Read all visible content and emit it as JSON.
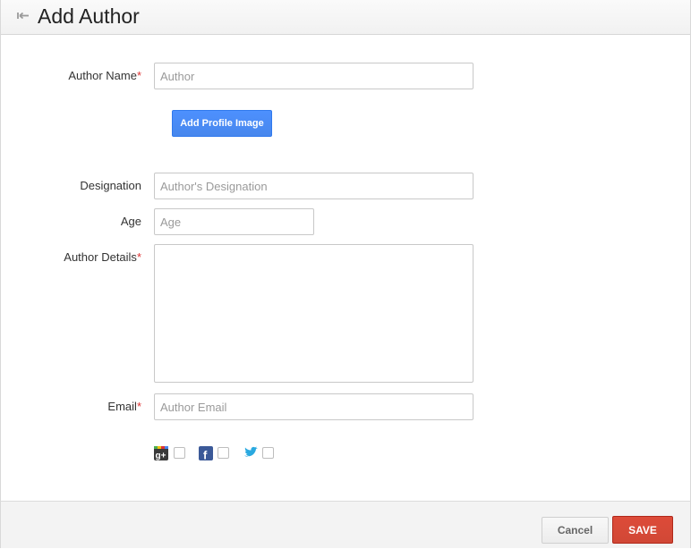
{
  "header": {
    "title": "Add Author"
  },
  "form": {
    "author_name": {
      "label": "Author Name",
      "required_mark": "*",
      "placeholder": "Author",
      "value": ""
    },
    "add_profile_image_label": "Add Profile Image",
    "designation": {
      "label": "Designation",
      "placeholder": "Author's Designation",
      "value": ""
    },
    "age": {
      "label": "Age",
      "placeholder": "Age",
      "value": ""
    },
    "author_details": {
      "label": "Author Details",
      "required_mark": "*",
      "value": ""
    },
    "email": {
      "label": "Email",
      "required_mark": "*",
      "placeholder": "Author Email",
      "value": ""
    },
    "social": [
      {
        "name": "google-plus",
        "icon": "google-plus-icon",
        "checked": false
      },
      {
        "name": "facebook",
        "icon": "facebook-icon",
        "checked": false
      },
      {
        "name": "twitter",
        "icon": "twitter-icon",
        "checked": false
      }
    ]
  },
  "footer": {
    "cancel_label": "Cancel",
    "save_label": "SAVE"
  },
  "colors": {
    "primary_button": "#4d90fe",
    "save_button": "#d14836",
    "required": "#dd3333"
  }
}
